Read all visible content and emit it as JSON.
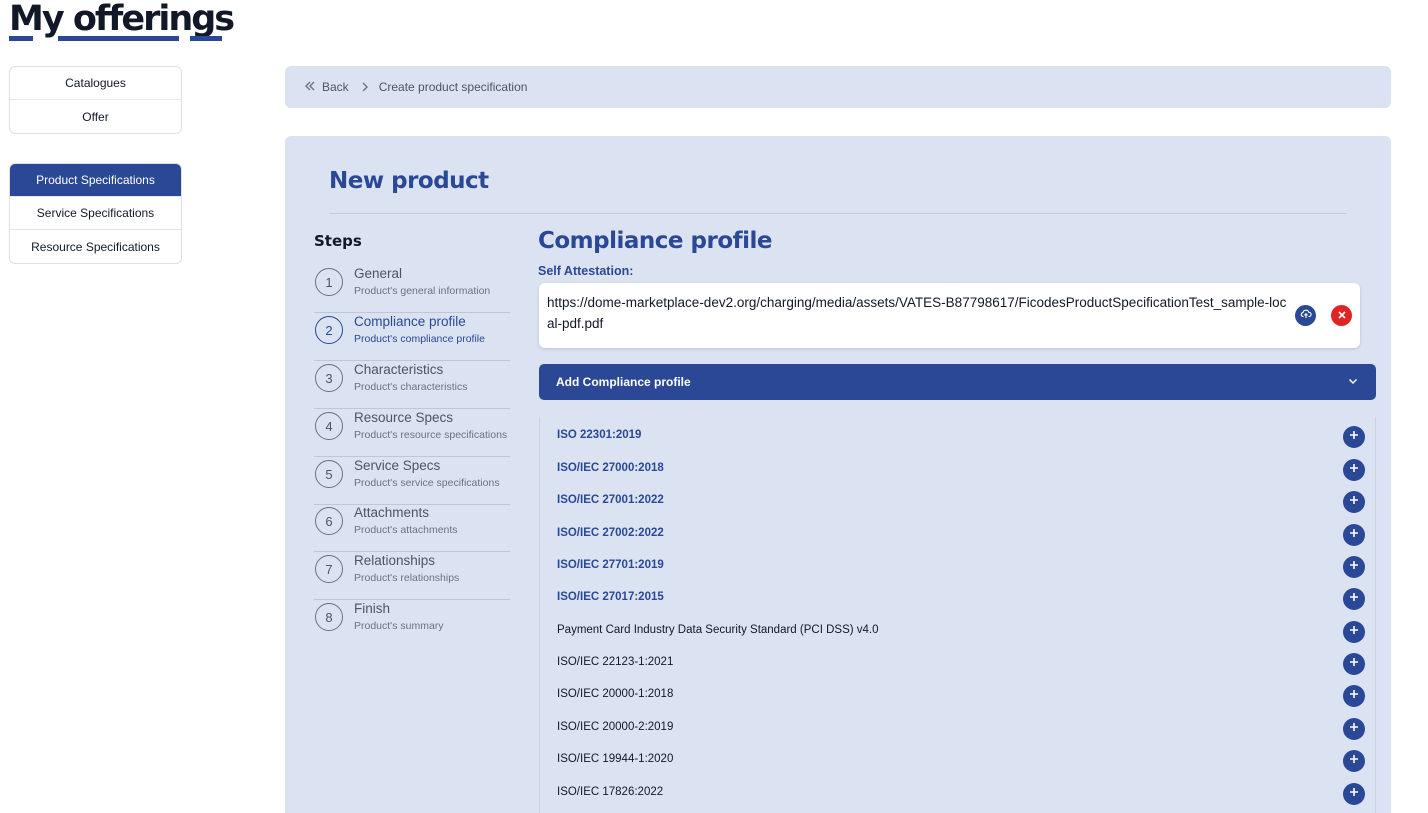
{
  "page": {
    "title": "My offerings"
  },
  "sidebar": {
    "top_items": [
      {
        "label": "Catalogues"
      },
      {
        "label": "Offer"
      }
    ],
    "spec_items": [
      {
        "label": "Product Specifications",
        "active": true
      },
      {
        "label": "Service Specifications",
        "active": false
      },
      {
        "label": "Resource Specifications",
        "active": false
      }
    ]
  },
  "breadcrumb": {
    "back_label": "Back",
    "current": "Create product specification"
  },
  "main": {
    "heading": "New product"
  },
  "steps": {
    "title": "Steps",
    "items": [
      {
        "number": "1",
        "label": "General",
        "sub": "Product's general information"
      },
      {
        "number": "2",
        "label": "Compliance profile",
        "sub": "Product's compliance profile",
        "active": true
      },
      {
        "number": "3",
        "label": "Characteristics",
        "sub": "Product's characteristics"
      },
      {
        "number": "4",
        "label": "Resource Specs",
        "sub": "Product's resource specifications"
      },
      {
        "number": "5",
        "label": "Service Specs",
        "sub": "Product's service specifications"
      },
      {
        "number": "6",
        "label": "Attachments",
        "sub": "Product's attachments"
      },
      {
        "number": "7",
        "label": "Relationships",
        "sub": "Product's relationships"
      },
      {
        "number": "8",
        "label": "Finish",
        "sub": "Product's summary"
      }
    ]
  },
  "compliance": {
    "title": "Compliance profile",
    "self_attestation_label": "Self Attestation:",
    "self_attestation_url": "https://dome-marketplace-dev2.org/charging/media/assets/VATES-B87798617/FicodesProductSpecificationTest_sample-local-pdf.pdf",
    "add_profile_label": "Add Compliance profile",
    "certifications": [
      {
        "name": "ISO 22301:2019",
        "highlighted": true
      },
      {
        "name": "ISO/IEC 27000:2018",
        "highlighted": true
      },
      {
        "name": "ISO/IEC 27001:2022",
        "highlighted": true
      },
      {
        "name": "ISO/IEC 27002:2022",
        "highlighted": true
      },
      {
        "name": "ISO/IEC 27701:2019",
        "highlighted": true
      },
      {
        "name": "ISO/IEC 27017:2015",
        "highlighted": true
      },
      {
        "name": "Payment Card Industry Data Security Standard (PCI DSS) v4.0",
        "highlighted": false
      },
      {
        "name": "ISO/IEC 22123-1:2021",
        "highlighted": false
      },
      {
        "name": "ISO/IEC 20000-1:2018",
        "highlighted": false
      },
      {
        "name": "ISO/IEC 20000-2:2019",
        "highlighted": false
      },
      {
        "name": "ISO/IEC 19944-1:2020",
        "highlighted": false
      },
      {
        "name": "ISO/IEC 17826:2022",
        "highlighted": false
      }
    ]
  },
  "colors": {
    "primary": "#2a4895",
    "panel": "#dbe3f3",
    "danger": "#e02424"
  }
}
